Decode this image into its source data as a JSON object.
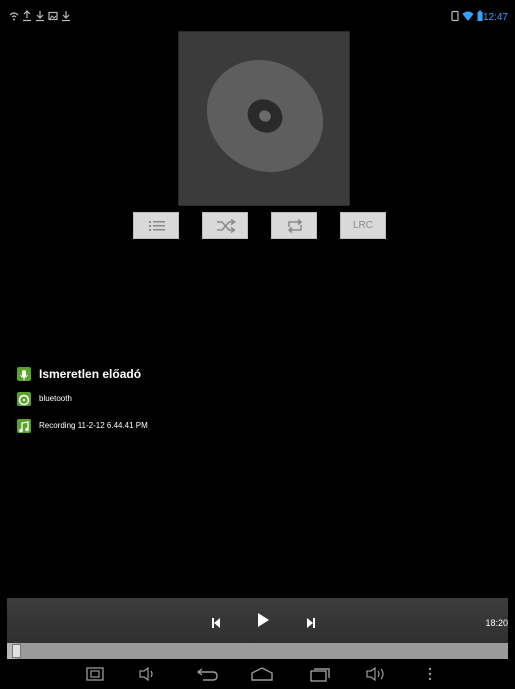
{
  "status_bar": {
    "icons": [
      "wifi-icon",
      "upload-icon",
      "download-icon",
      "image-icon",
      "download-icon",
      "sim-icon",
      "wifi-signal-icon",
      "battery-icon"
    ],
    "time": "12:47"
  },
  "player": {
    "controls": [
      "playlist-icon",
      "shuffle-icon",
      "repeat-icon"
    ],
    "lrc_label": "LRC"
  },
  "track": {
    "artist": "Ismeretlen előadó",
    "album": "bluetooth",
    "title": "Recording 11-2-12 6.44.41 PM"
  },
  "playback": {
    "elapsed": "18:20",
    "progress": 0.02
  },
  "colors": {
    "accent": "#36a2ff",
    "icon_green": "#5aa32b",
    "panel": "#3a3a3a"
  },
  "navbar": {
    "icons": [
      "screenshot-icon",
      "volume-down-icon",
      "back-icon",
      "home-icon",
      "recent-apps-icon",
      "volume-up-icon",
      "menu-icon"
    ]
  }
}
